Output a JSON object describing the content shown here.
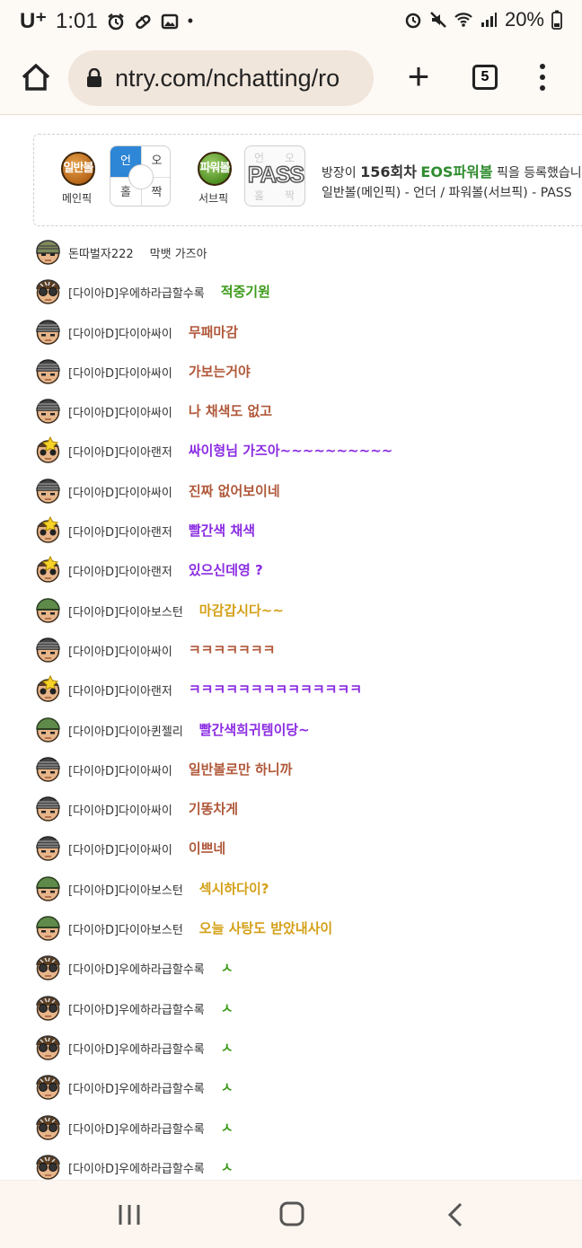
{
  "status": {
    "carrier": "U⁺",
    "time": "1:01",
    "battery": "20%",
    "colors": {
      "text": "#222222"
    }
  },
  "browser": {
    "url": "ntry.com/nchatting/ro",
    "tab_count": "5",
    "icons": [
      "home-icon",
      "lock-icon",
      "plus-icon",
      "tabs-icon",
      "menu-icon"
    ]
  },
  "pick": {
    "main_ball": "일반볼",
    "main_caption": "메인픽",
    "main_grid": {
      "tl": "언",
      "tr": "오",
      "bl": "홀",
      "br": "짝",
      "selected": "tl"
    },
    "sub_ball": "파워볼",
    "sub_caption": "서브픽",
    "sub_grid": {
      "tl": "언",
      "tr": "오",
      "bl": "홀",
      "br": "짝"
    },
    "pass_label": "PASS",
    "info_prefix": "방장이 ",
    "round": "156회차",
    "game": "EOS파워볼",
    "info_suffix": " 픽을 등록했습니다",
    "detail": "일반볼(메인픽) - 언더 / 파워볼(서브픽) - PASS"
  },
  "chat": [
    {
      "nick": "돈따벌자222",
      "msg": "막뱃 가즈아",
      "avatar": "helmet",
      "color": "#333333",
      "bold": false
    },
    {
      "nick": "[다이아D]우에하라급할수록",
      "msg": "적중기원",
      "avatar": "goggles",
      "color": "#3d9b1a",
      "bold": true
    },
    {
      "nick": "[다이아D]다이아싸이",
      "msg": "무패마감",
      "avatar": "stripes",
      "color": "#b0583a",
      "bold": true
    },
    {
      "nick": "[다이아D]다이아싸이",
      "msg": "가보는거야",
      "avatar": "stripes",
      "color": "#b0583a",
      "bold": true
    },
    {
      "nick": "[다이아D]다이아싸이",
      "msg": "나 채색도 없고",
      "avatar": "stripes",
      "color": "#b0583a",
      "bold": true
    },
    {
      "nick": "[다이아D]다이아랜저",
      "msg": "싸이형님 가즈아~~~~~~~~~~",
      "avatar": "star",
      "color": "#8a2be2",
      "bold": true
    },
    {
      "nick": "[다이아D]다이아싸이",
      "msg": "진짜 없어보이네",
      "avatar": "stripes",
      "color": "#b0583a",
      "bold": true
    },
    {
      "nick": "[다이아D]다이아랜저",
      "msg": "빨간색 채색",
      "avatar": "star",
      "color": "#8a2be2",
      "bold": true
    },
    {
      "nick": "[다이아D]다이아랜저",
      "msg": "있으신데영 ?",
      "avatar": "star",
      "color": "#8a2be2",
      "bold": true
    },
    {
      "nick": "[다이아D]다이아보스턴",
      "msg": "마감갑시다~~",
      "avatar": "army",
      "color": "#d4a017",
      "bold": true
    },
    {
      "nick": "[다이아D]다이아싸이",
      "msg": "ㅋㅋㅋㅋㅋㅋㅋ",
      "avatar": "stripes",
      "color": "#b0583a",
      "bold": true
    },
    {
      "nick": "[다이아D]다이아랜저",
      "msg": "ㅋㅋㅋㅋㅋㅋㅋㅋㅋㅋㅋㅋㅋㅋ",
      "avatar": "star",
      "color": "#8a2be2",
      "bold": true
    },
    {
      "nick": "[다이아D]다이아퀸젤리",
      "msg": "빨간색희귀템이당~",
      "avatar": "army",
      "color": "#8a2be2",
      "bold": true
    },
    {
      "nick": "[다이아D]다이아싸이",
      "msg": "일반볼로만 하니까",
      "avatar": "stripes",
      "color": "#b0583a",
      "bold": true
    },
    {
      "nick": "[다이아D]다이아싸이",
      "msg": "기똥차게",
      "avatar": "stripes",
      "color": "#b0583a",
      "bold": true
    },
    {
      "nick": "[다이아D]다이아싸이",
      "msg": "이쁘네",
      "avatar": "stripes",
      "color": "#b0583a",
      "bold": true
    },
    {
      "nick": "[다이아D]다이아보스턴",
      "msg": "섹시하다이?",
      "avatar": "army",
      "color": "#d4a017",
      "bold": true
    },
    {
      "nick": "[다이아D]다이아보스턴",
      "msg": "오늘 사탕도 받았내사이",
      "avatar": "army",
      "color": "#d4a017",
      "bold": true
    },
    {
      "nick": "[다이아D]우에하라급할수록",
      "msg": "ㅅ",
      "avatar": "goggles",
      "color": "#3d9b1a",
      "bold": true
    },
    {
      "nick": "[다이아D]우에하라급할수록",
      "msg": "ㅅ",
      "avatar": "goggles",
      "color": "#3d9b1a",
      "bold": true
    },
    {
      "nick": "[다이아D]우에하라급할수록",
      "msg": "ㅅ",
      "avatar": "goggles",
      "color": "#3d9b1a",
      "bold": true
    },
    {
      "nick": "[다이아D]우에하라급할수록",
      "msg": "ㅅ",
      "avatar": "goggles",
      "color": "#3d9b1a",
      "bold": true
    },
    {
      "nick": "[다이아D]우에하라급할수록",
      "msg": "ㅅ",
      "avatar": "goggles",
      "color": "#3d9b1a",
      "bold": true
    },
    {
      "nick": "[다이아D]우에하라급할수록",
      "msg": "ㅅ",
      "avatar": "goggles",
      "color": "#3d9b1a",
      "bold": true
    }
  ],
  "nav": {
    "icons": [
      "recents-icon",
      "home-nav-icon",
      "back-icon"
    ]
  }
}
